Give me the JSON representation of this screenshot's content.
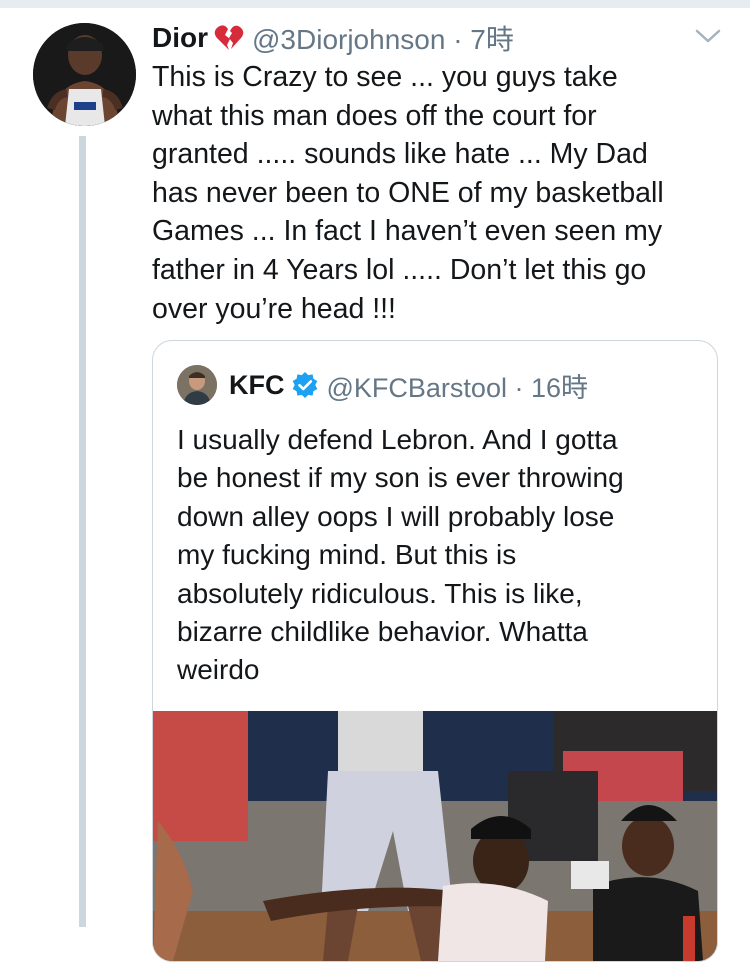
{
  "colors": {
    "text": "#14171a",
    "secondary": "#657786",
    "border": "#ccd6dd",
    "divider": "#e6ecf0",
    "verified": "#1da1f2",
    "heart": "#d62b3b"
  },
  "tweet": {
    "author_name": "Dior",
    "name_emoji": "broken-heart-icon",
    "handle_time": "@3Diorjohnson · 7時",
    "text": "This is Crazy to see ... you guys take\nwhat this man does off the court for\ngranted ..... sounds like hate ... My Dad\nhas never been to ONE of my basketball\nGames ... In fact  I haven’t even seen my\nfather in 4 Years lol ..... Don’t let this go\nover you’re head !!!"
  },
  "quoted": {
    "author_name": "KFC",
    "verified_icon": "verified-badge-icon",
    "handle_time": "@KFCBarstool · 16時",
    "text": "I usually defend Lebron. And I gotta\nbe honest if my son is ever throwing\ndown alley oops I will probably lose\nmy fucking mind. But this is\nabsolutely ridiculous. This is like,\nbizarre childlike behavior. Whatta\nweirdo"
  }
}
